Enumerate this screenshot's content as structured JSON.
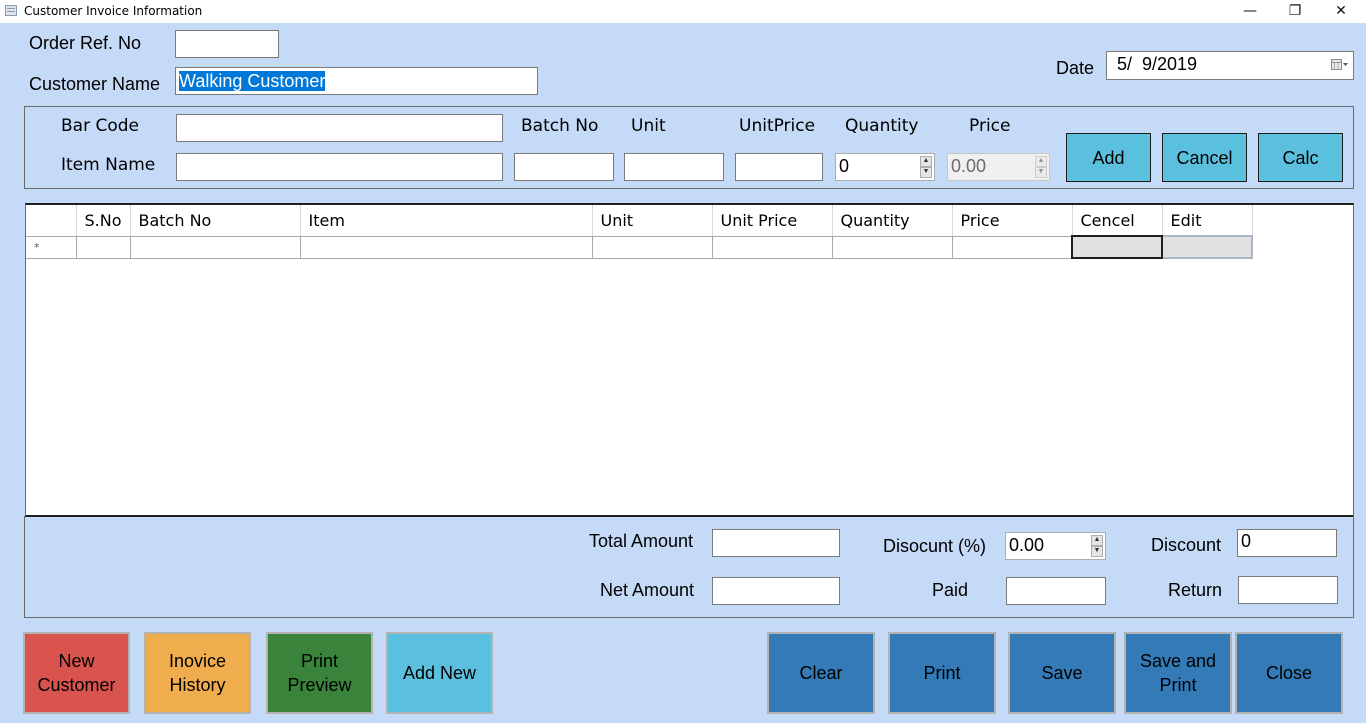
{
  "window": {
    "title": "Customer Invoice Information",
    "minimize_glyph": "—",
    "restore_glyph": "❐",
    "close_glyph": "✕"
  },
  "header": {
    "order_ref_label": "Order Ref. No",
    "order_ref_value": "",
    "customer_name_label": "Customer Name",
    "customer_name_value": "Walking Customer",
    "date_label": "Date",
    "date_value": "5/  9/2019"
  },
  "item_entry": {
    "barcode_label": "Bar Code",
    "barcode_value": "",
    "item_name_label": "Item Name",
    "item_name_value": "",
    "batch_no_label": "Batch No",
    "batch_no_value": "",
    "unit_label": "Unit",
    "unit_value": "",
    "unit_price_label": "UnitPrice",
    "unit_price_value": "",
    "quantity_label": "Quantity",
    "quantity_value": "0",
    "price_label": "Price",
    "price_value": "0.00",
    "add_label": "Add",
    "cancel_label": "Cancel",
    "calc_label": "Calc"
  },
  "grid": {
    "columns": [
      "",
      "S.No",
      "Batch No",
      "Item",
      "Unit",
      "Unit Price",
      "Quantity",
      "Price",
      "Cencel",
      "Edit"
    ],
    "new_row_marker": "*"
  },
  "totals": {
    "total_amount_label": "Total Amount",
    "total_amount_value": "",
    "net_amount_label": "Net Amount",
    "net_amount_value": "",
    "discount_pct_label": "Disocunt (%)",
    "discount_pct_value": "0.00",
    "paid_label": "Paid",
    "paid_value": "",
    "discount_label": "Discount",
    "discount_value": "0",
    "return_label": "Return",
    "return_value": ""
  },
  "actions": {
    "new_customer": "New Customer",
    "invoice_history": "Inovice History",
    "print_preview": "Print Preview",
    "add_new": "Add New",
    "clear": "Clear",
    "print": "Print",
    "save": "Save",
    "save_and_print": "Save and Print",
    "close": "Close"
  },
  "colors": {
    "background": "#c4daf6",
    "cyan_button": "#5bc0de",
    "red_button": "#d9534f",
    "orange_button": "#f0ad4e",
    "green_button": "#3a833a",
    "blue_button": "#337ab7",
    "selection": "#0078d7"
  }
}
